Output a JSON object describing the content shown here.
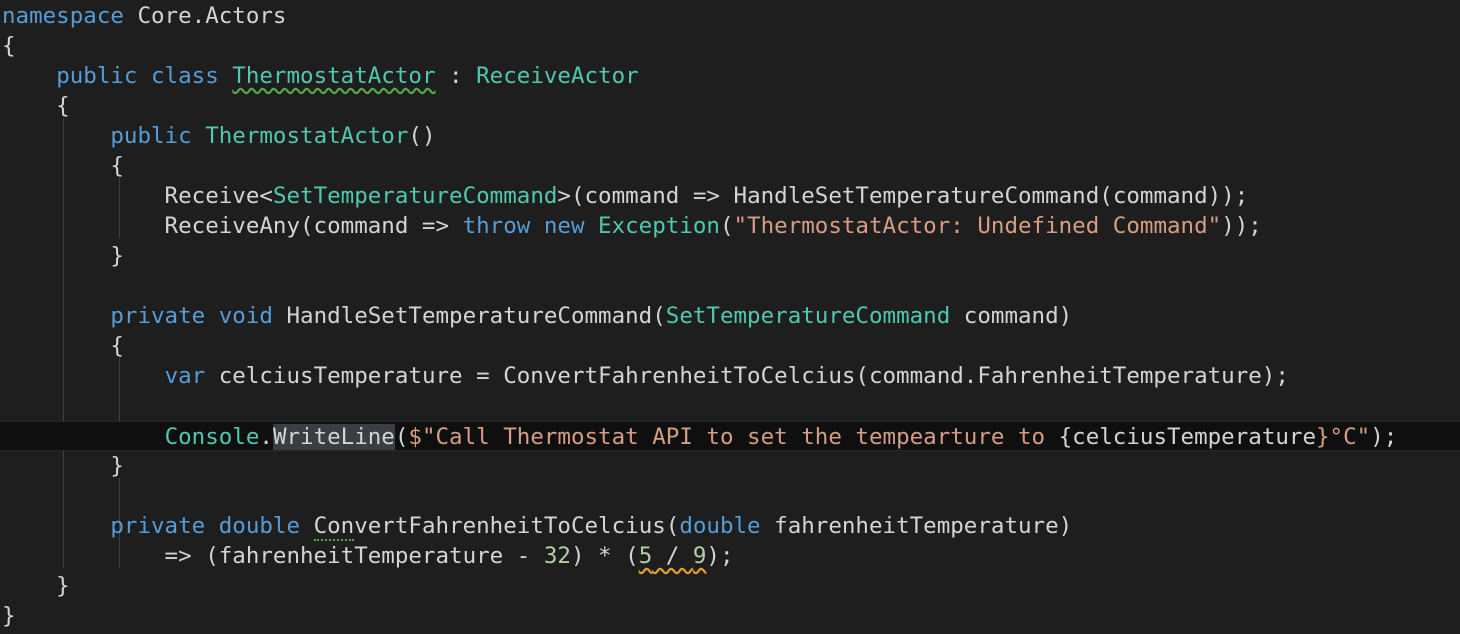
{
  "editor": {
    "language": "C#",
    "theme": "dark",
    "colors": {
      "background": "#1e1e1e",
      "keyword": "#569cd6",
      "type": "#4ec9b0",
      "string": "#d69d85",
      "number": "#b5cea8",
      "text": "#d4d4d4",
      "current_line": "#0f0f0f"
    },
    "current_line_index": 14,
    "lines": [
      {
        "tokens": [
          [
            "kw",
            "namespace"
          ],
          [
            "pl",
            " Core.Actors"
          ]
        ]
      },
      {
        "tokens": [
          [
            "pl",
            "{"
          ]
        ]
      },
      {
        "tokens": [
          [
            "pl",
            "    "
          ],
          [
            "kw",
            "public"
          ],
          [
            "pl",
            " "
          ],
          [
            "kw",
            "class"
          ],
          [
            "pl",
            " "
          ],
          [
            "ty",
            "ThermostatActor",
            "squig-green"
          ],
          [
            "pl",
            " : "
          ],
          [
            "ty",
            "ReceiveActor"
          ]
        ]
      },
      {
        "tokens": [
          [
            "pl",
            "    {"
          ]
        ]
      },
      {
        "tokens": [
          [
            "pl",
            "        "
          ],
          [
            "kw",
            "public"
          ],
          [
            "pl",
            " "
          ],
          [
            "ty",
            "ThermostatActor"
          ],
          [
            "pl",
            "()"
          ]
        ]
      },
      {
        "tokens": [
          [
            "pl",
            "        {"
          ]
        ]
      },
      {
        "tokens": [
          [
            "pl",
            "            Receive<"
          ],
          [
            "ty",
            "SetTemperatureCommand"
          ],
          [
            "pl",
            ">(command => HandleSetTemperatureCommand(command));"
          ]
        ]
      },
      {
        "tokens": [
          [
            "pl",
            "            ReceiveAny(command => "
          ],
          [
            "kw",
            "throw"
          ],
          [
            "pl",
            " "
          ],
          [
            "kw",
            "new"
          ],
          [
            "pl",
            " "
          ],
          [
            "ty",
            "Exception"
          ],
          [
            "pl",
            "("
          ],
          [
            "st",
            "\"ThermostatActor: Undefined Command\""
          ],
          [
            "pl",
            "));"
          ]
        ]
      },
      {
        "tokens": [
          [
            "pl",
            "        }"
          ]
        ]
      },
      {
        "tokens": []
      },
      {
        "tokens": [
          [
            "pl",
            "        "
          ],
          [
            "kw",
            "private"
          ],
          [
            "pl",
            " "
          ],
          [
            "kw",
            "void"
          ],
          [
            "pl",
            " HandleSetTemperatureCommand("
          ],
          [
            "ty",
            "SetTemperatureCommand"
          ],
          [
            "pl",
            " command)"
          ]
        ]
      },
      {
        "tokens": [
          [
            "pl",
            "        {"
          ]
        ]
      },
      {
        "tokens": [
          [
            "pl",
            "            "
          ],
          [
            "kw",
            "var"
          ],
          [
            "pl",
            " celciusTemperature = ConvertFahrenheitToCelcius(command.FahrenheitTemperature);"
          ]
        ]
      },
      {
        "tokens": []
      },
      {
        "tokens": [
          [
            "pl",
            "            "
          ],
          [
            "ty",
            "Console"
          ],
          [
            "pl",
            "."
          ],
          [
            "pl",
            "WriteLine",
            "hl"
          ],
          [
            "pl",
            "("
          ],
          [
            "st",
            "$\"Call Thermostat API to set the tempearture to "
          ],
          [
            "pl",
            "{celciusTemperature"
          ],
          [
            "st",
            "}°C\""
          ],
          [
            "pl",
            ");"
          ]
        ]
      },
      {
        "tokens": [
          [
            "pl",
            "        }"
          ]
        ]
      },
      {
        "tokens": []
      },
      {
        "tokens": [
          [
            "pl",
            "        "
          ],
          [
            "kw",
            "private"
          ],
          [
            "pl",
            " "
          ],
          [
            "kw",
            "double"
          ],
          [
            "pl",
            " "
          ],
          [
            "pl",
            "Con",
            "dotted-green"
          ],
          [
            "pl",
            "vertFahrenheitToCelcius("
          ],
          [
            "kw",
            "double"
          ],
          [
            "pl",
            " fahrenheitTemperature)"
          ]
        ]
      },
      {
        "tokens": [
          [
            "pl",
            "            => (fahrenheitTemperature - "
          ],
          [
            "nu",
            "32"
          ],
          [
            "pl",
            ") * ("
          ],
          [
            "nu",
            "5",
            "squig-orange"
          ],
          [
            "pl",
            " / ",
            "squig-orange"
          ],
          [
            "nu",
            "9",
            "squig-orange"
          ],
          [
            "pl",
            ");"
          ]
        ]
      },
      {
        "tokens": [
          [
            "pl",
            "    }"
          ]
        ]
      },
      {
        "tokens": [
          [
            "pl",
            "}"
          ]
        ]
      }
    ]
  }
}
